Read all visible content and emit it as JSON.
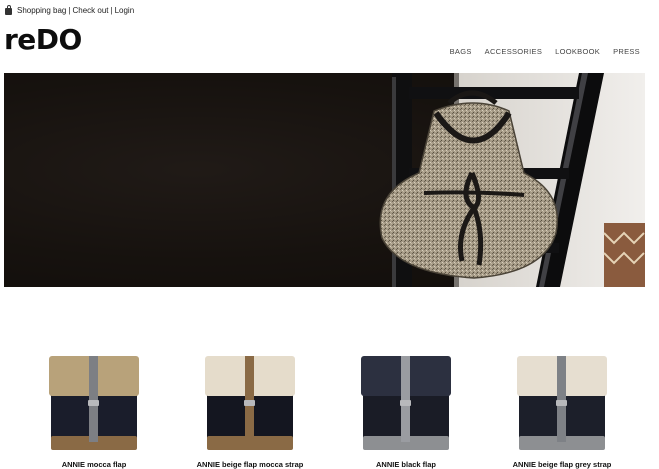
{
  "utility_bar": {
    "shopping_bag": "Shopping bag",
    "checkout": "Check out",
    "login": "Login",
    "separator": "|"
  },
  "brand": {
    "logo": "reDO"
  },
  "nav": {
    "items": [
      "BAGS",
      "ACCESSORIES",
      "LOOKBOOK",
      "PRESS"
    ]
  },
  "hero": {
    "image": "knitted-backpack-on-chair"
  },
  "products": [
    {
      "name": "ANNIE mocca flap",
      "flap_color": "#b8a27a",
      "body_color": "#1a1d2b",
      "stripe_color": "#7d7f84",
      "base_color": "#8a6a45"
    },
    {
      "name": "ANNIE beige flap mocca strap",
      "flap_color": "#e5dccb",
      "body_color": "#141620",
      "stripe_color": "#8a6a45",
      "base_color": "#8a6a45"
    },
    {
      "name": "ANNIE black flap",
      "flap_color": "#2c3040",
      "body_color": "#1a1c26",
      "stripe_color": "#9a9ca1",
      "base_color": "#8d8f92"
    },
    {
      "name": "ANNIE beige flap grey strap",
      "flap_color": "#e6ded0",
      "body_color": "#1c1f2a",
      "stripe_color": "#7e8186",
      "base_color": "#8d8f92"
    }
  ]
}
